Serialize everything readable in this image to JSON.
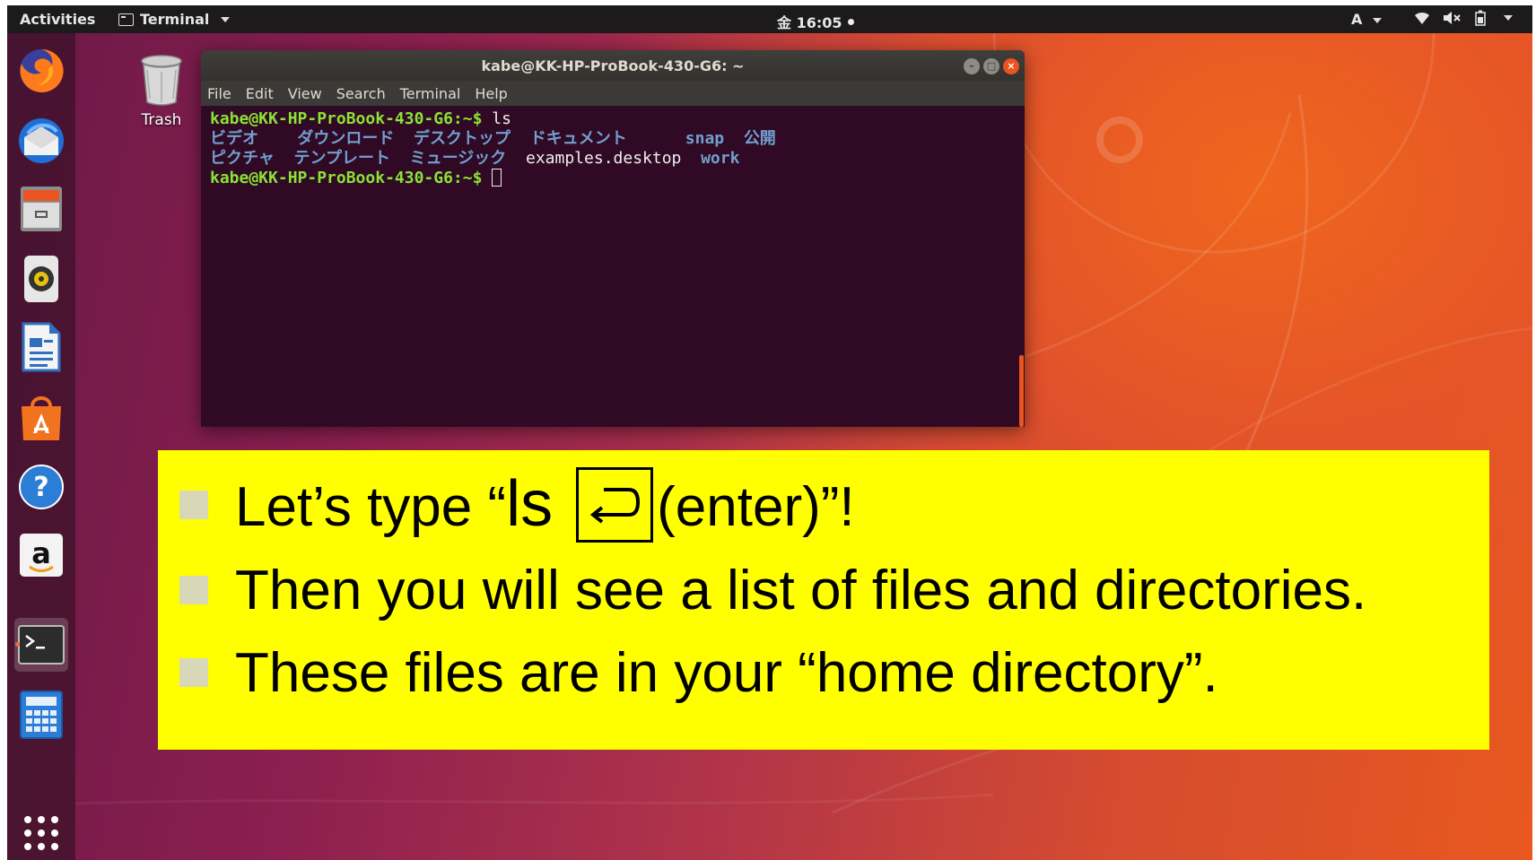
{
  "topbar": {
    "activities": "Activities",
    "app_name": "Terminal",
    "clock": "金 16:05",
    "input_method": "A"
  },
  "dock": {
    "items": [
      "firefox-icon",
      "thunderbird-icon",
      "files-icon",
      "rhythmbox-icon",
      "libreoffice-writer-icon",
      "software-center-icon",
      "help-icon",
      "amazon-icon",
      "terminal-icon",
      "calculator-icon",
      "show-applications-icon"
    ]
  },
  "desktop": {
    "trash_label": "Trash"
  },
  "terminal": {
    "title": "kabe@KK-HP-ProBook-430-G6: ~",
    "menu": [
      "File",
      "Edit",
      "View",
      "Search",
      "Terminal",
      "Help"
    ],
    "prompt": "kabe@KK-HP-ProBook-430-G6:~$",
    "command": "ls",
    "ls_row1": [
      "ビデオ",
      "ダウンロード",
      "デスクトップ",
      "ドキュメント",
      "snap",
      "公開"
    ],
    "ls_row2": [
      "ピクチャ",
      "テンプレート",
      "ミュージック",
      "examples.desktop",
      "work"
    ]
  },
  "callout": {
    "line1_prefix": "Let’s type “",
    "line1_ls": "ls",
    "line1_suffix": "(enter)”!",
    "line2": "Then you will see a list of files and directories.",
    "line3": "These files are in your “home directory”."
  },
  "colors": {
    "callout_bg": "#ffff00",
    "terminal_bg": "#300a24",
    "prompt_green": "#8ae234",
    "dir_blue": "#729fcf",
    "ubuntu_orange": "#e95420"
  }
}
